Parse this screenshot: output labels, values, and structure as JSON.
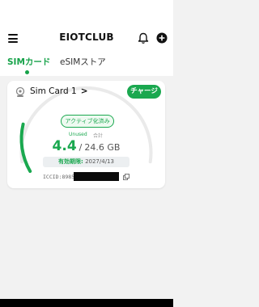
{
  "app": {
    "title": "EIOTCLUB"
  },
  "header": {
    "menu_icon": "menu-icon",
    "bell_icon": "bell-icon",
    "add_icon": "plus-circle-icon"
  },
  "tabs": [
    {
      "label": "SIMカード",
      "active": true
    },
    {
      "label": "eSIMストア",
      "active": false
    }
  ],
  "card": {
    "name": "Sim Card 1",
    "chevron": ">",
    "charge_label": "チャージ",
    "status": "アクティブ化済み",
    "unused_label": "Unused",
    "total_label": "合計",
    "used_value": "4.4",
    "separator": "/",
    "total_value": "24.6 GB",
    "remaining_fraction": 0.18,
    "expiry_label": "有効期限:",
    "expiry_date": "2027/4/13",
    "iccid_prefix": "ICCID:89852"
  },
  "colors": {
    "accent": "#1aa84f",
    "arc_track": "#eaeaea"
  }
}
